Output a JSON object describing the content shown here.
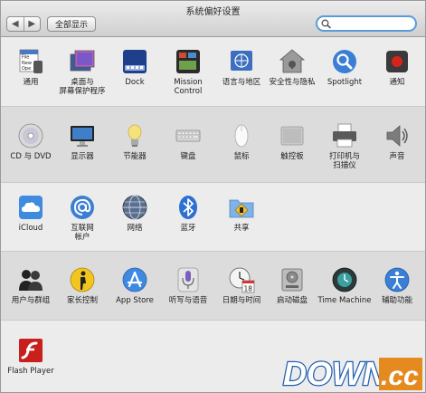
{
  "window": {
    "title": "系统偏好设置",
    "back_glyph": "◀",
    "forward_glyph": "▶",
    "show_all": "全部显示",
    "search_value": ""
  },
  "sections": [
    {
      "items": [
        {
          "label": "通用"
        },
        {
          "label": "桌面与\n屏幕保护程序"
        },
        {
          "label": "Dock"
        },
        {
          "label": "Mission\nControl"
        },
        {
          "label": "语言与地区"
        },
        {
          "label": "安全性与隐私"
        },
        {
          "label": "Spotlight"
        },
        {
          "label": "通知"
        }
      ]
    },
    {
      "items": [
        {
          "label": "CD 与 DVD"
        },
        {
          "label": "显示器"
        },
        {
          "label": "节能器"
        },
        {
          "label": "键盘"
        },
        {
          "label": "鼠标"
        },
        {
          "label": "触控板"
        },
        {
          "label": "打印机与\n扫描仪"
        },
        {
          "label": "声音"
        }
      ]
    },
    {
      "items": [
        {
          "label": "iCloud"
        },
        {
          "label": "互联网\n帐户"
        },
        {
          "label": "网络"
        },
        {
          "label": "蓝牙"
        },
        {
          "label": "共享"
        }
      ]
    },
    {
      "items": [
        {
          "label": "用户与群组"
        },
        {
          "label": "家长控制"
        },
        {
          "label": "App Store"
        },
        {
          "label": "听写与语音"
        },
        {
          "label": "日期与时间"
        },
        {
          "label": "启动磁盘"
        },
        {
          "label": "Time Machine"
        },
        {
          "label": "辅助功能"
        }
      ]
    },
    {
      "items": [
        {
          "label": "Flash Player"
        }
      ]
    }
  ],
  "general_icon_text": {
    "line1": "File",
    "line2": "New",
    "line3": "Ope"
  },
  "calendar_day": "18",
  "watermark": {
    "text": "DOWN",
    "suffix": ".cc"
  },
  "colors": {
    "accent_blue": "#3a7fd5",
    "watermark_blue": "#1f5fae",
    "watermark_orange": "#e58a1f",
    "flash_red": "#c8201c"
  }
}
